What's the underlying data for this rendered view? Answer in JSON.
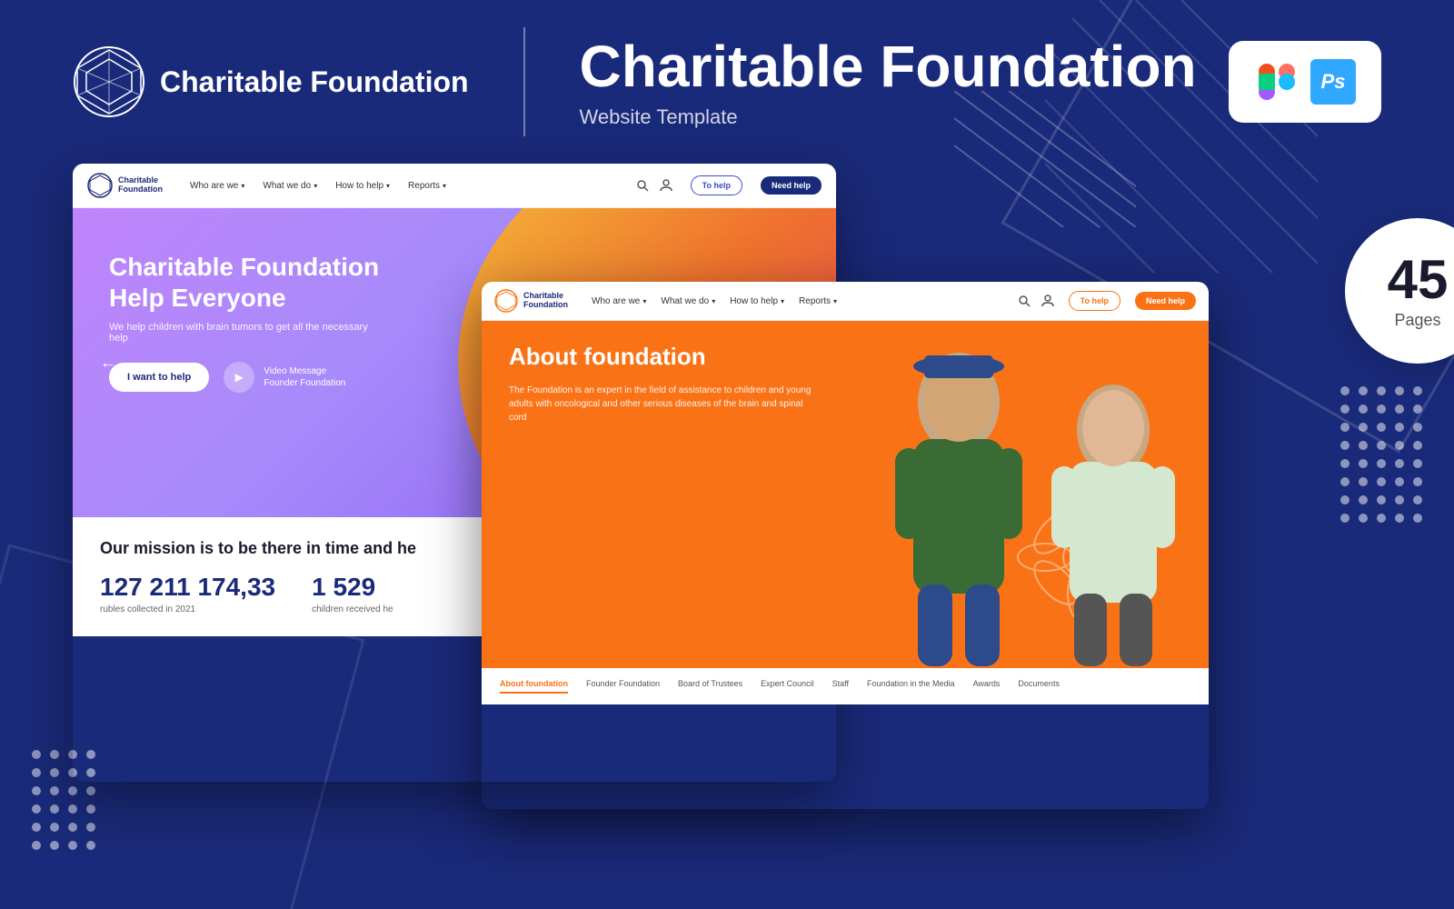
{
  "header": {
    "logo_text": "Charitable\nFoundation",
    "title": "Charitable Foundation",
    "subtitle": "Website Template",
    "tools": {
      "figma_label": "Figma",
      "ps_label": "Ps"
    }
  },
  "nav1": {
    "logo_line1": "Charitable",
    "logo_line2": "Foundation",
    "links": [
      "Who are we",
      "What we do",
      "How to help",
      "Reports"
    ],
    "btn1": "To help",
    "btn2": "Need help"
  },
  "nav2": {
    "logo_line1": "Charitable",
    "logo_line2": "Foundation",
    "links": [
      "Who are we",
      "What we do",
      "How to help",
      "Reports"
    ],
    "btn1": "To help",
    "btn2": "Need help"
  },
  "hero": {
    "title": "Charitable Foundation Help Everyone",
    "description": "We help children with brain tumors to get all the necessary help",
    "btn_main": "I want to help",
    "btn_video_title": "Video Message",
    "btn_video_sub": "Founder Foundation"
  },
  "stats": {
    "mission": "Our mission is to be there in time and he",
    "items": [
      {
        "number": "127 211 174,33",
        "label": "rubles collected in 2021"
      },
      {
        "number": "1 529",
        "label": "children received he"
      }
    ]
  },
  "pages_badge": {
    "number": "45",
    "label": "Pages"
  },
  "about": {
    "title": "About foundation",
    "description": "The Foundation is an expert in the field of assistance to children and young adults with oncological and other serious diseases of the brain and spinal cord"
  },
  "bottom_tabs": {
    "items": [
      {
        "label": "About foundation",
        "active": true
      },
      {
        "label": "Founder Foundation",
        "active": false
      },
      {
        "label": "Board of Trustees",
        "active": false
      },
      {
        "label": "Expert Council",
        "active": false
      },
      {
        "label": "Staff",
        "active": false
      },
      {
        "label": "Foundation in the Media",
        "active": false
      },
      {
        "label": "Awards",
        "active": false
      },
      {
        "label": "Documents",
        "active": false
      }
    ]
  }
}
